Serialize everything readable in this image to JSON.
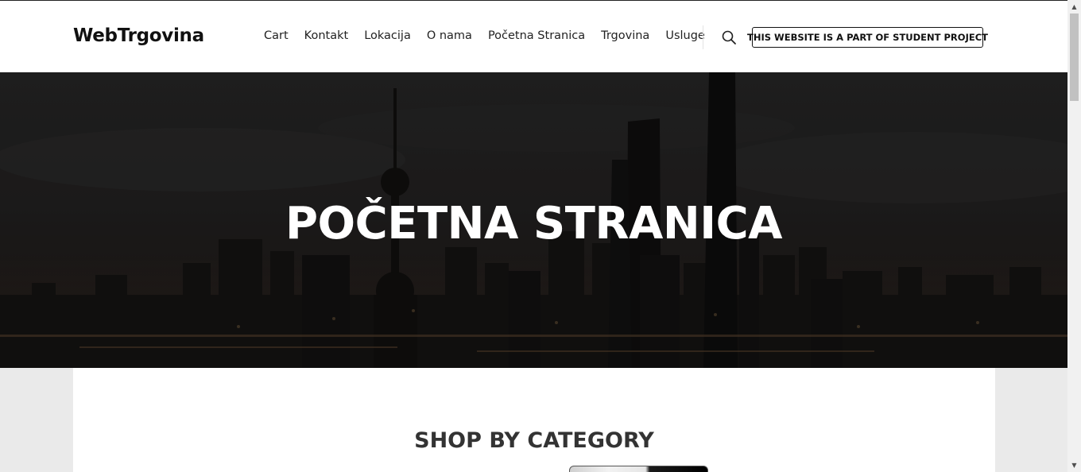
{
  "header": {
    "logo": "WebTrgovina",
    "nav": [
      {
        "label": "Cart"
      },
      {
        "label": "Kontakt"
      },
      {
        "label": "Lokacija"
      },
      {
        "label": "O nama"
      },
      {
        "label": "Početna Stranica"
      },
      {
        "label": "Trgovina"
      },
      {
        "label": "Usluge"
      }
    ],
    "search_icon": "search-icon",
    "notice_button": "THIS WEBSITE IS A PART OF STUDENT PROJECT"
  },
  "hero": {
    "title": "POČETNA STRANICA",
    "background": "night-city-skyline"
  },
  "content": {
    "section_title": "SHOP BY CATEGORY"
  },
  "colors": {
    "text": "#222222",
    "hero_overlay": "#1d1d1d",
    "page_bg": "#eaeaea"
  }
}
